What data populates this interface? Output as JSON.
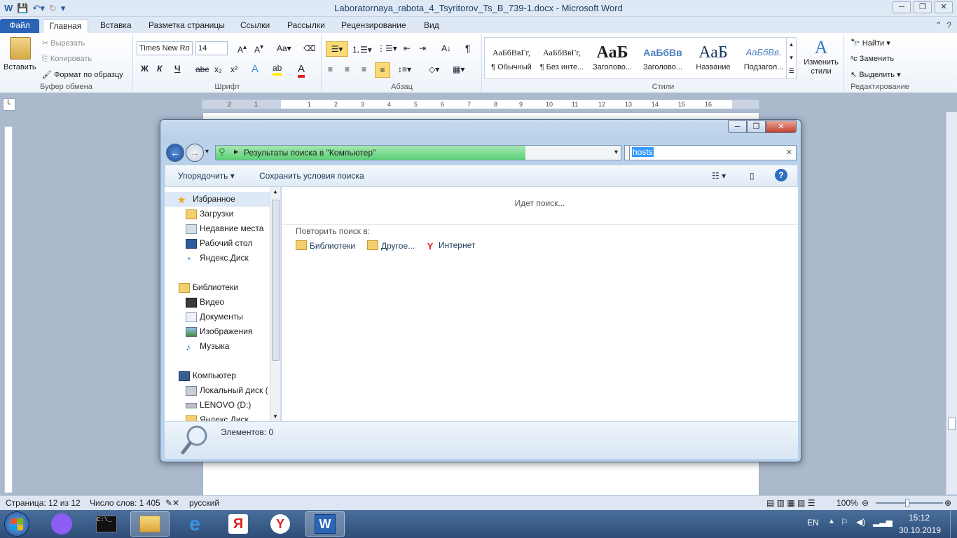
{
  "window": {
    "title": "Laboratornaya_rabota_4_Tsyritorov_Ts_B_739-1.docx - Microsoft Word",
    "controls": [
      "─",
      "❐",
      "✕"
    ]
  },
  "ribbon": {
    "tabs": [
      "Файл",
      "Главная",
      "Вставка",
      "Разметка страницы",
      "Ссылки",
      "Рассылки",
      "Рецензирование",
      "Вид"
    ],
    "clipboard": {
      "group_label": "Буфер обмена",
      "paste": "Вставить",
      "cut": "Вырезать",
      "copy": "Копировать",
      "format_painter": "Формат по образцу"
    },
    "font": {
      "group_label": "Шрифт",
      "font_name": "Times New Ro",
      "font_size": "14",
      "bold": "Ж",
      "italic": "К",
      "underline": "Ч"
    },
    "paragraph": {
      "group_label": "Абзац"
    },
    "styles": {
      "group_label": "Стили",
      "items": [
        {
          "sample": "АаБбВвГг,",
          "name": "¶ Обычный"
        },
        {
          "sample": "АаБбВвГг,",
          "name": "¶ Без инте..."
        },
        {
          "sample": "АаБ",
          "name": "Заголово..."
        },
        {
          "sample": "АаБбВв",
          "name": "Заголово..."
        },
        {
          "sample": "АаБ",
          "name": "Название"
        },
        {
          "sample": "АаБбВв.",
          "name": "Подзагол..."
        }
      ],
      "change_styles": "Изменить стили"
    },
    "editing": {
      "group_label": "Редактирование",
      "find": "Найти",
      "replace": "Заменить",
      "select": "Выделить"
    }
  },
  "ruler": {
    "marks": [
      "2",
      "1",
      "1",
      "2",
      "3",
      "4",
      "5",
      "6",
      "7",
      "8",
      "9",
      "10",
      "11",
      "12",
      "13",
      "14",
      "15",
      "16"
    ]
  },
  "explorer": {
    "address": "Результаты поиска в \"Компьютер\"",
    "search_value": "hosts",
    "toolbar": {
      "organize": "Упорядочить",
      "save_search": "Сохранить условия поиска"
    },
    "nav": {
      "favorites_header": "Избранное",
      "favorites": [
        "Загрузки",
        "Недавние места",
        "Рабочий стол",
        "Яндекс.Диск"
      ],
      "libraries_header": "Библиотеки",
      "libraries": [
        "Видео",
        "Документы",
        "Изображения",
        "Музыка"
      ],
      "computer_header": "Компьютер",
      "computer": [
        "Локальный диск (",
        "LENOVO (D:)",
        "Яндекс.Диск"
      ]
    },
    "status_searching": "Идет поиск...",
    "repeat_search_label": "Повторить поиск в:",
    "repeat_locations": [
      "Библиотеки",
      "Другое...",
      "Интернет"
    ],
    "items_count": "Элементов: 0"
  },
  "statusbar": {
    "page": "Страница: 12 из 12",
    "words": "Число слов: 1 405",
    "language": "русский",
    "zoom": "100%"
  },
  "taskbar": {
    "lang": "EN",
    "time": "15:12",
    "date": "30.10.2019"
  },
  "colors": {
    "word_blue": "#2a64b6",
    "progress_green": "#5bd074",
    "selection_blue": "#3399ff"
  }
}
